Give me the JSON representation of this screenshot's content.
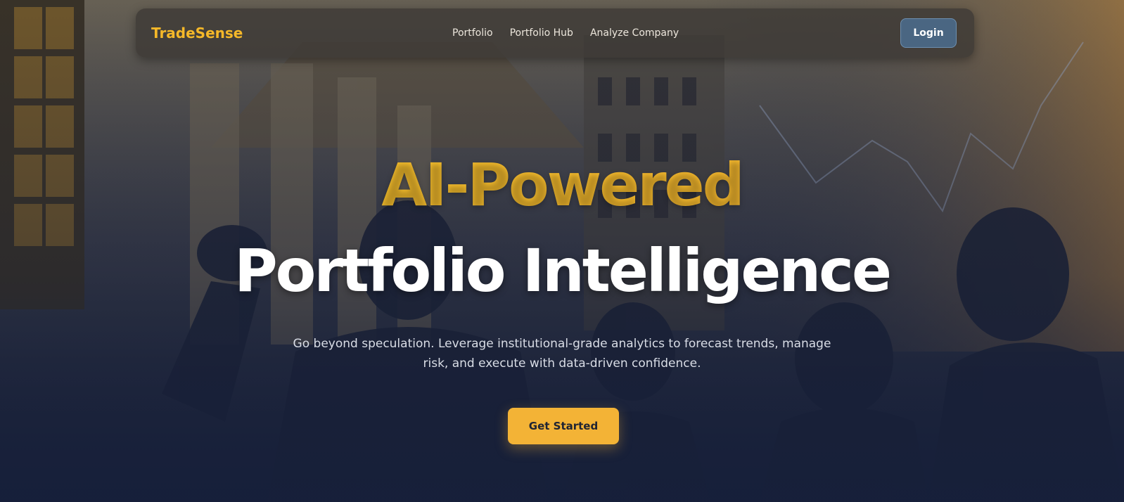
{
  "nav": {
    "logo": "TradeSense",
    "links": [
      "Portfolio",
      "Portfolio Hub",
      "Analyze Company"
    ],
    "login_label": "Login"
  },
  "hero": {
    "headline_accent": "AI-Powered",
    "headline_main": "Portfolio Intelligence",
    "subtext": "Go beyond speculation. Leverage institutional-grade analytics to forecast trends, manage risk, and execute with data-driven confidence.",
    "cta_label": "Get Started",
    "background_image": "stock-exchange-businessmen-photo"
  },
  "colors": {
    "accent": "#f5b829",
    "button": "#f3b336",
    "login_button": "#4a6682",
    "navy": "#1a2238"
  }
}
